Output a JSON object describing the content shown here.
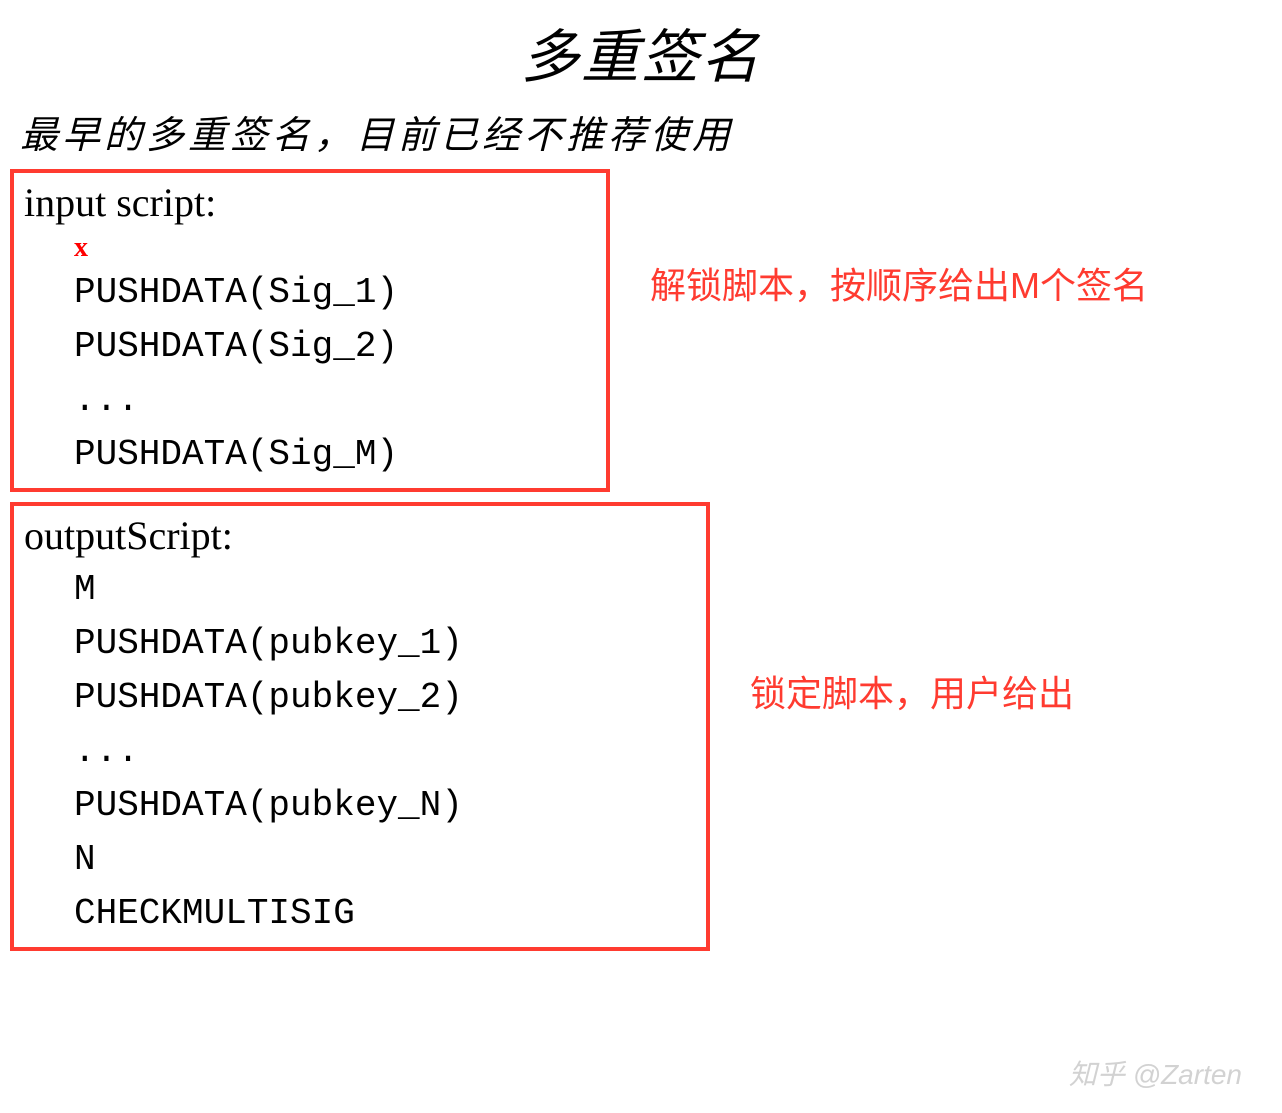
{
  "title": "多重签名",
  "subtitle": "最早的多重签名，目前已经不推荐使用",
  "input_script": {
    "header": "input script:",
    "x_marker": "x",
    "lines": [
      "PUSHDATA(Sig_1)",
      "PUSHDATA(Sig_2)",
      "...",
      "PUSHDATA(Sig_M)"
    ],
    "annotation": "解锁脚本，按顺序给出M个签名"
  },
  "output_script": {
    "header": "outputScript:",
    "lines": [
      "M",
      "PUSHDATA(pubkey_1)",
      "PUSHDATA(pubkey_2)",
      "...",
      "PUSHDATA(pubkey_N)",
      "N",
      "CHECKMULTISIG"
    ],
    "annotation": "锁定脚本，用户给出"
  },
  "watermark": "知乎 @Zarten"
}
